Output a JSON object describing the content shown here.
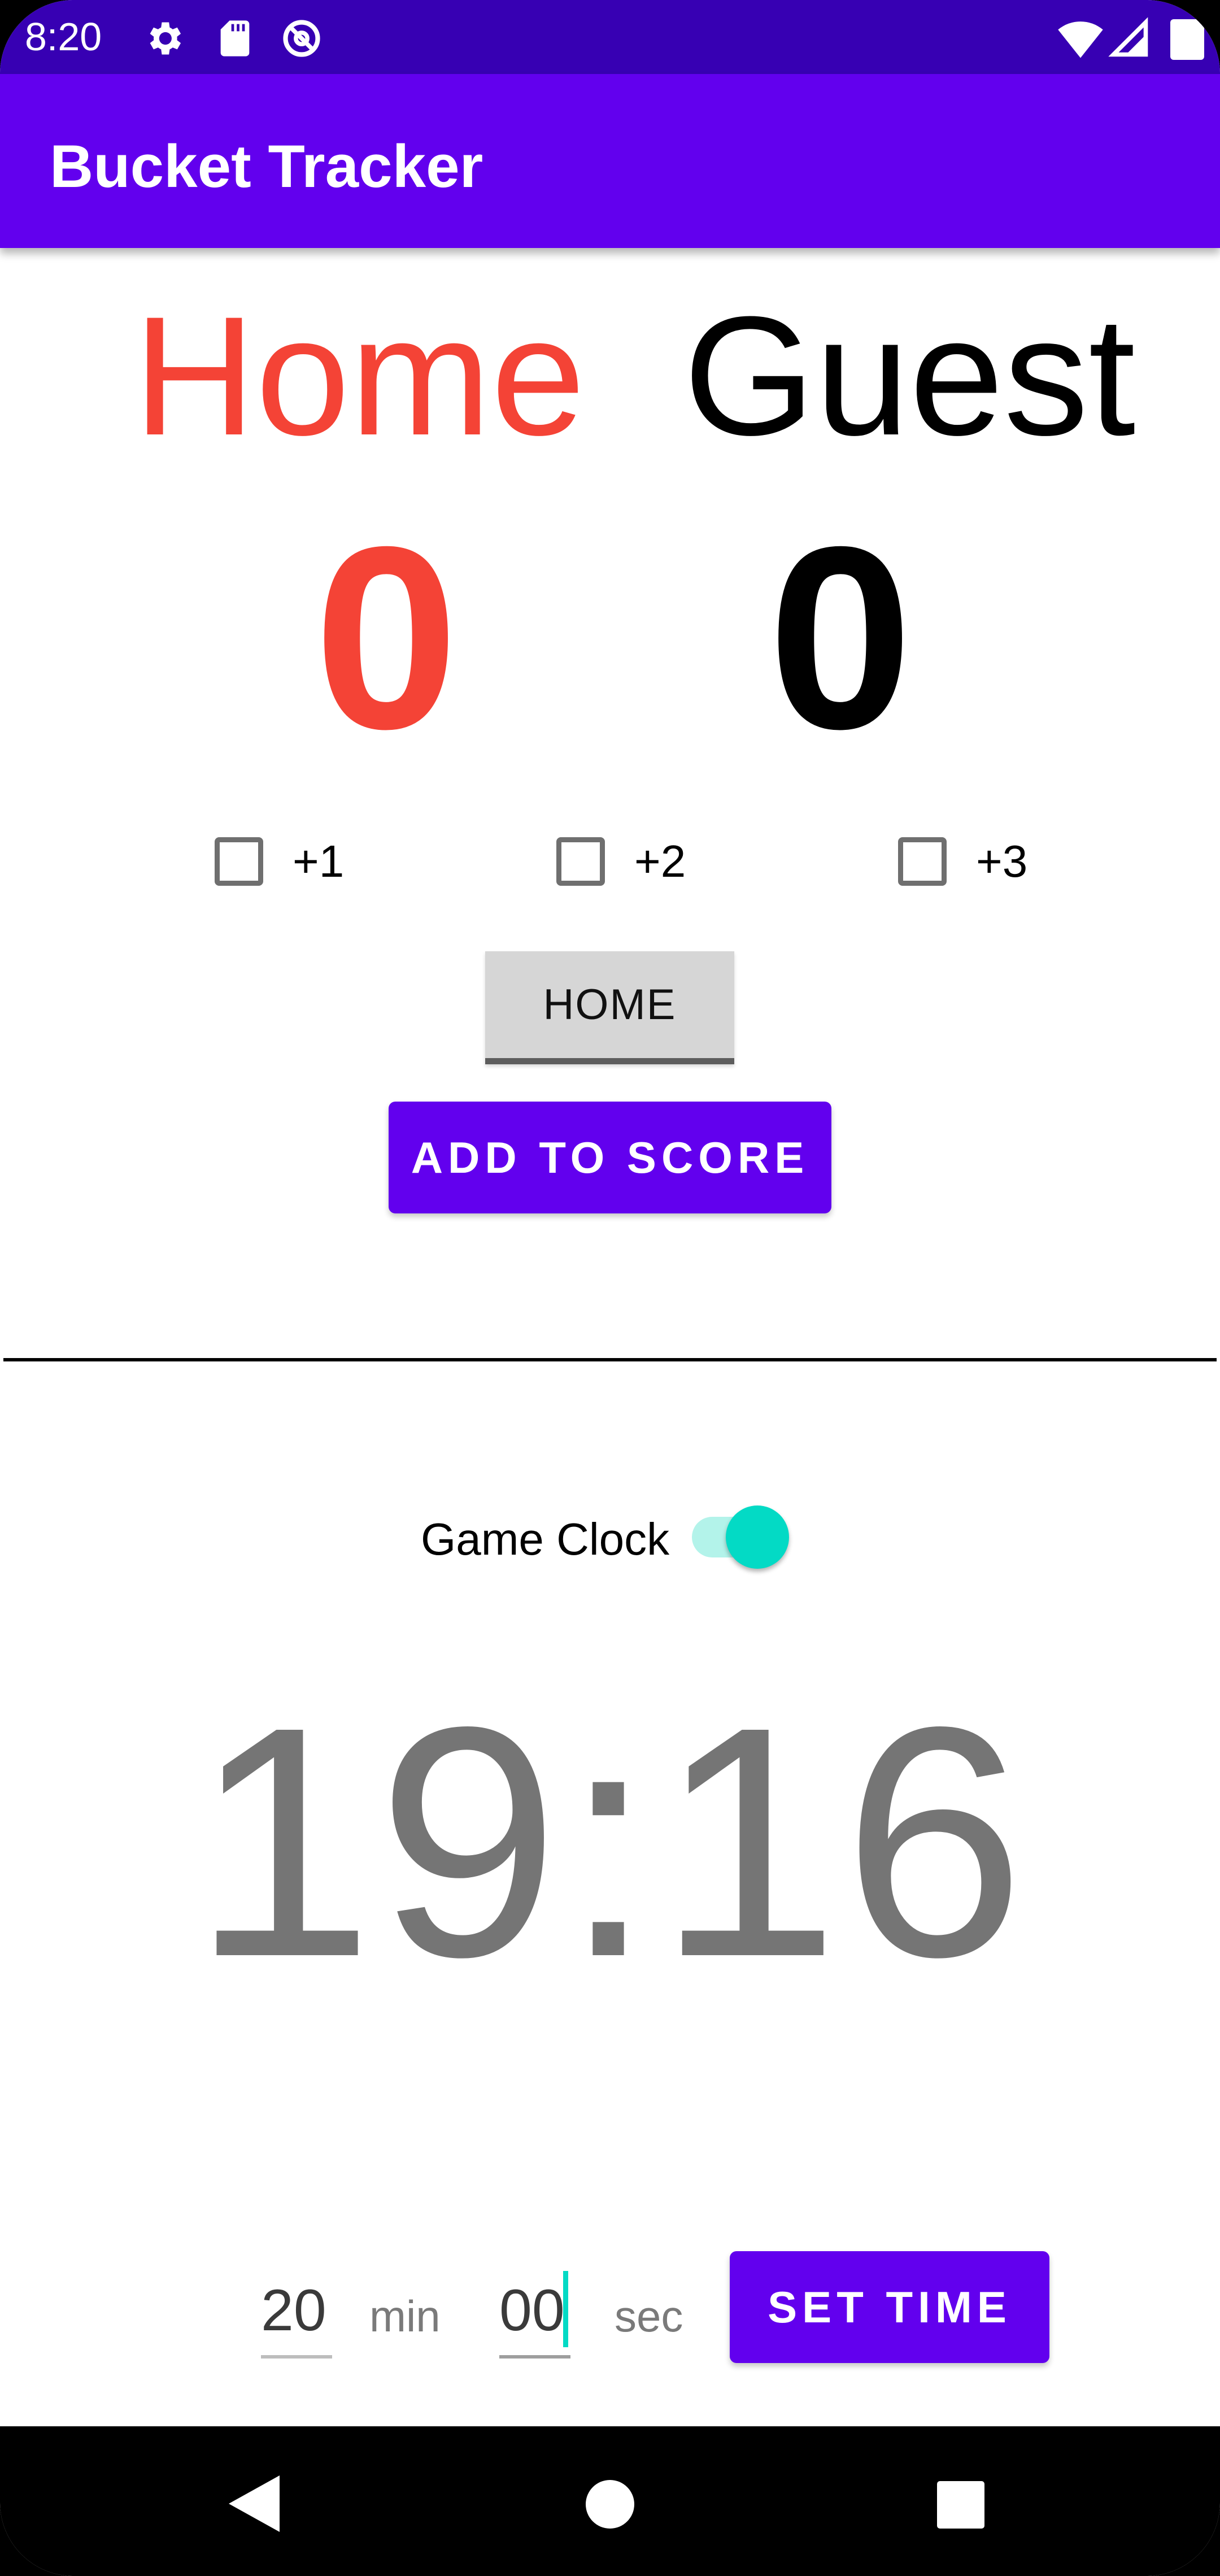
{
  "status_bar": {
    "time": "8:20",
    "icons": [
      "gear-icon",
      "sd-card-icon",
      "do-not-disturb-icon",
      "wifi-icon",
      "signal-icon",
      "battery-icon"
    ]
  },
  "app_bar": {
    "title": "Bucket Tracker",
    "color": "#6200ee",
    "status_color": "#3700b3"
  },
  "teams": {
    "home": {
      "label": "Home",
      "score": "0",
      "color": "#f44336"
    },
    "guest": {
      "label": "Guest",
      "score": "0",
      "color": "#000000"
    }
  },
  "points_options": [
    {
      "label": "+1",
      "checked": false
    },
    {
      "label": "+2",
      "checked": false
    },
    {
      "label": "+3",
      "checked": false
    }
  ],
  "team_toggle_button": {
    "label": "HOME"
  },
  "add_score_button": {
    "label": "ADD TO SCORE"
  },
  "game_clock": {
    "label": "Game Clock",
    "enabled": true,
    "display": "19:16",
    "accent": "#03dac5"
  },
  "time_entry": {
    "minutes_value": "20",
    "minutes_unit": "min",
    "seconds_value": "00",
    "seconds_unit": "sec",
    "set_button_label": "SET TIME"
  },
  "nav_bar": {
    "icons": [
      "back-icon",
      "home-icon",
      "recents-icon"
    ]
  }
}
